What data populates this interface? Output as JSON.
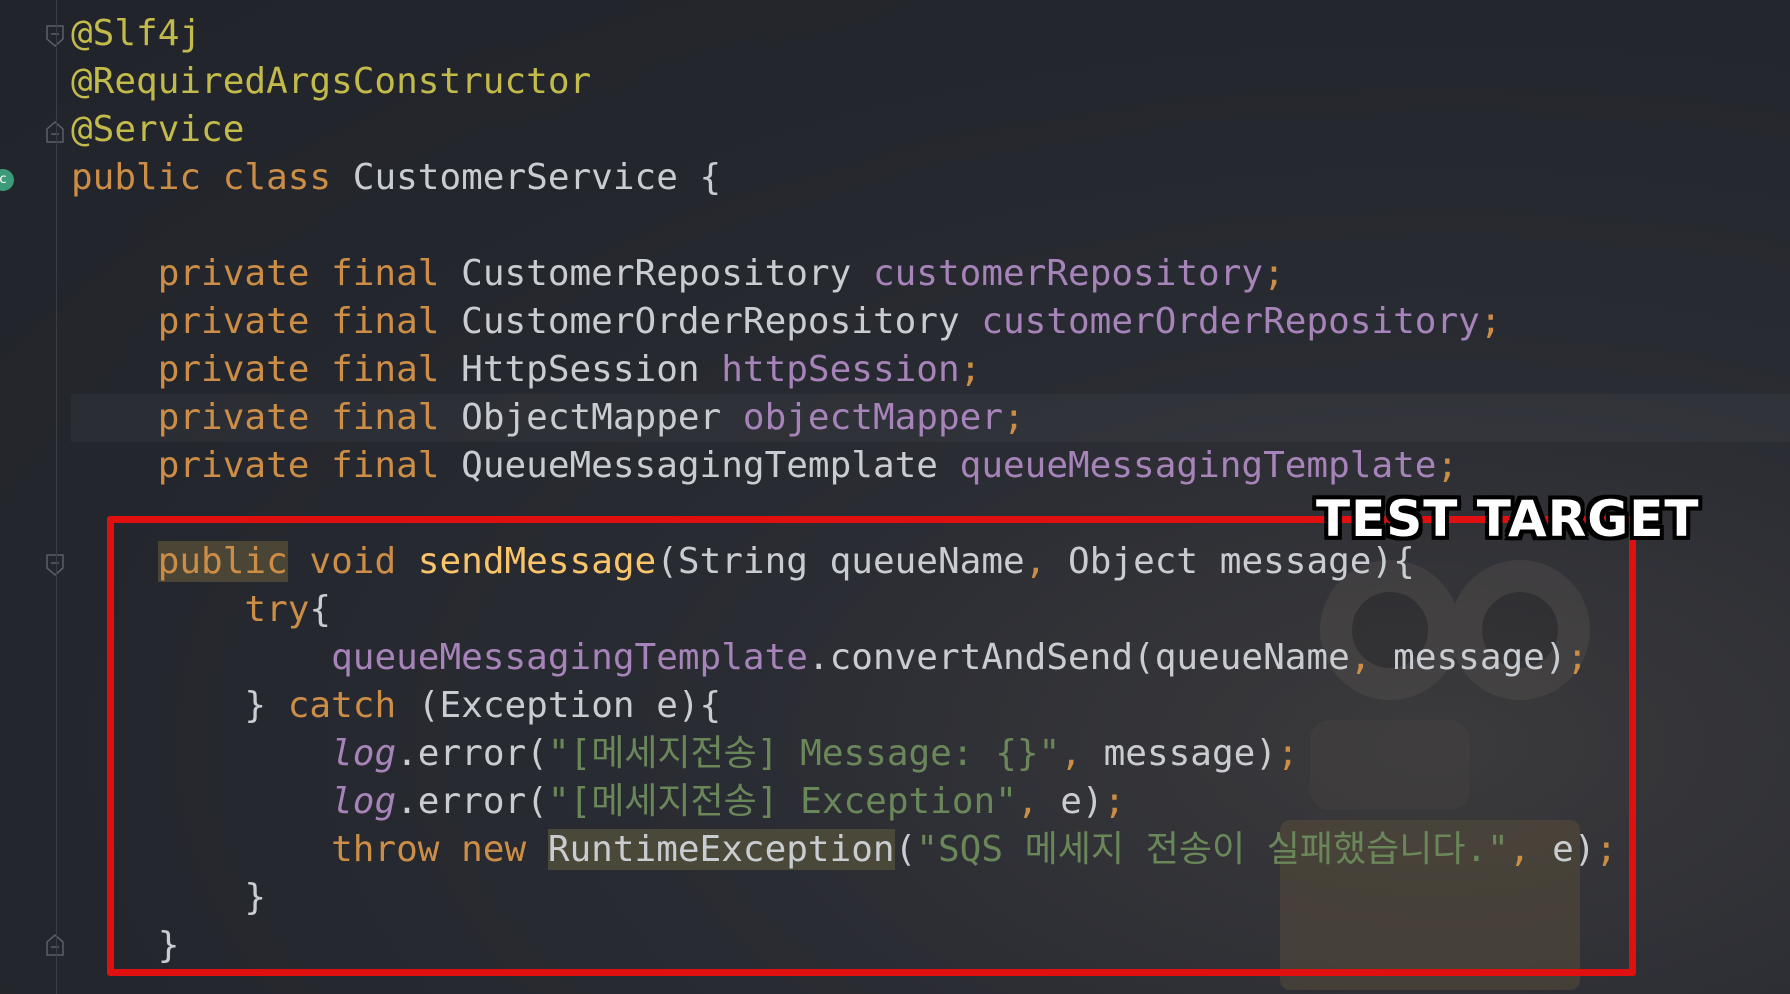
{
  "editor": {
    "lines": [
      {
        "segments": [
          {
            "t": "@Slf4j",
            "c": "ann"
          }
        ]
      },
      {
        "segments": [
          {
            "t": "@RequiredArgsConstructor",
            "c": "ann"
          }
        ]
      },
      {
        "segments": [
          {
            "t": "@Service",
            "c": "ann"
          }
        ]
      },
      {
        "segments": [
          {
            "t": "public class ",
            "c": "kw"
          },
          {
            "t": "CustomerService {",
            "c": "cls"
          }
        ]
      },
      {
        "segments": [
          {
            "t": "",
            "c": "cls"
          }
        ]
      },
      {
        "segments": [
          {
            "t": "    private final ",
            "c": "kw"
          },
          {
            "t": "CustomerRepository ",
            "c": "cls"
          },
          {
            "t": "customerRepository",
            "c": "fld"
          },
          {
            "t": ";",
            "c": "punc"
          }
        ]
      },
      {
        "segments": [
          {
            "t": "    private final ",
            "c": "kw"
          },
          {
            "t": "CustomerOrderRepository ",
            "c": "cls"
          },
          {
            "t": "customerOrderRepository",
            "c": "fld"
          },
          {
            "t": ";",
            "c": "punc"
          }
        ]
      },
      {
        "segments": [
          {
            "t": "    private final ",
            "c": "kw"
          },
          {
            "t": "HttpSession ",
            "c": "cls"
          },
          {
            "t": "httpSession",
            "c": "fld"
          },
          {
            "t": ";",
            "c": "punc"
          }
        ]
      },
      {
        "hl": true,
        "segments": [
          {
            "t": "    private final ",
            "c": "kw"
          },
          {
            "t": "ObjectMapper ",
            "c": "cls"
          },
          {
            "t": "objectMapper",
            "c": "fld"
          },
          {
            "t": ";",
            "c": "punc"
          }
        ]
      },
      {
        "segments": [
          {
            "t": "    private final ",
            "c": "kw"
          },
          {
            "t": "QueueMessagingTemplate ",
            "c": "cls"
          },
          {
            "t": "queueMessagingTemplate",
            "c": "fld"
          },
          {
            "t": ";",
            "c": "punc"
          }
        ]
      },
      {
        "segments": [
          {
            "t": "",
            "c": "cls"
          }
        ]
      },
      {
        "segments": [
          {
            "t": "    ",
            "c": "cls"
          },
          {
            "t": "public",
            "c": "kw kw-hl"
          },
          {
            "t": " void ",
            "c": "kw"
          },
          {
            "t": "sendMessage",
            "c": "meth"
          },
          {
            "t": "(String queueName",
            "c": "cls"
          },
          {
            "t": ", ",
            "c": "punc"
          },
          {
            "t": "Object message){",
            "c": "cls"
          }
        ]
      },
      {
        "segments": [
          {
            "t": "        try",
            "c": "kw"
          },
          {
            "t": "{",
            "c": "cls"
          }
        ]
      },
      {
        "segments": [
          {
            "t": "            ",
            "c": "cls"
          },
          {
            "t": "queueMessagingTemplate",
            "c": "fld"
          },
          {
            "t": ".convertAndSend(queueName",
            "c": "call"
          },
          {
            "t": ", ",
            "c": "punc"
          },
          {
            "t": "message)",
            "c": "call"
          },
          {
            "t": ";",
            "c": "punc"
          }
        ]
      },
      {
        "segments": [
          {
            "t": "        } ",
            "c": "cls"
          },
          {
            "t": "catch ",
            "c": "kw"
          },
          {
            "t": "(Exception e){",
            "c": "cls"
          }
        ]
      },
      {
        "segments": [
          {
            "t": "            ",
            "c": "cls"
          },
          {
            "t": "log",
            "c": "log"
          },
          {
            "t": ".error(",
            "c": "call"
          },
          {
            "t": "\"[메세지전송] Message: {}\"",
            "c": "str"
          },
          {
            "t": ", ",
            "c": "punc"
          },
          {
            "t": "message)",
            "c": "call"
          },
          {
            "t": ";",
            "c": "punc"
          }
        ]
      },
      {
        "segments": [
          {
            "t": "            ",
            "c": "cls"
          },
          {
            "t": "log",
            "c": "log"
          },
          {
            "t": ".error(",
            "c": "call"
          },
          {
            "t": "\"[메세지전송] Exception\"",
            "c": "str"
          },
          {
            "t": ", ",
            "c": "punc"
          },
          {
            "t": "e)",
            "c": "call"
          },
          {
            "t": ";",
            "c": "punc"
          }
        ]
      },
      {
        "segments": [
          {
            "t": "            throw new ",
            "c": "kw"
          },
          {
            "t": "RuntimeException",
            "c": "cls cls-hl"
          },
          {
            "t": "(",
            "c": "cls"
          },
          {
            "t": "\"SQS 메세지 전송이 실패했습니다.\"",
            "c": "str"
          },
          {
            "t": ", ",
            "c": "punc"
          },
          {
            "t": "e)",
            "c": "call"
          },
          {
            "t": ";",
            "c": "punc"
          }
        ]
      },
      {
        "segments": [
          {
            "t": "        }",
            "c": "cls"
          }
        ]
      },
      {
        "segments": [
          {
            "t": "    }",
            "c": "cls"
          }
        ]
      }
    ]
  },
  "gutter": {
    "class_badge_label": "c"
  },
  "annotation": {
    "label": "TEST TARGET",
    "color": "#e01010"
  }
}
